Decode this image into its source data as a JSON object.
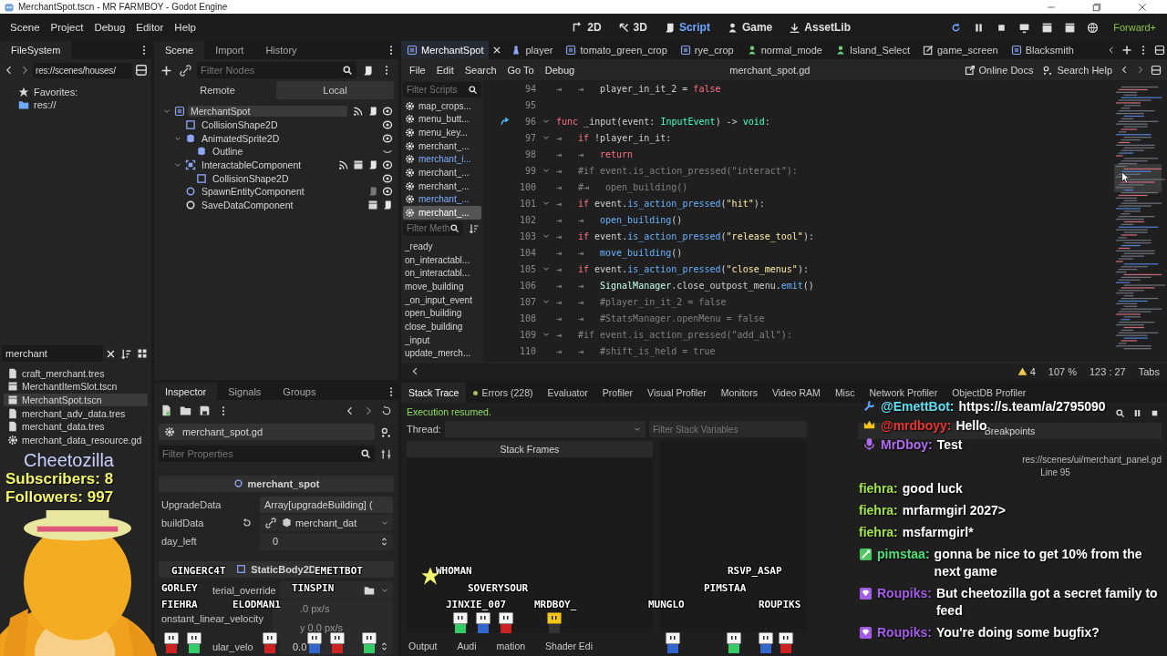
{
  "window": {
    "title": "MerchantSpot.tscn - MR FARMBOY - Godot Engine"
  },
  "menu": [
    "Scene",
    "Project",
    "Debug",
    "Editor",
    "Help"
  ],
  "workspaces": [
    {
      "label": "2D",
      "kind": "plane",
      "selected": false
    },
    {
      "label": "3D",
      "kind": "space",
      "selected": false
    },
    {
      "label": "Script",
      "kind": "script",
      "selected": true
    },
    {
      "label": "Game",
      "kind": "game",
      "selected": false
    },
    {
      "label": "AssetLib",
      "kind": "assetlib",
      "selected": false
    }
  ],
  "renderer": "Forward+",
  "filesystem": {
    "title": "FileSystem",
    "path": "res://scenes/houses/",
    "favorites": [
      {
        "label": "Favorites:",
        "kind": "star"
      },
      {
        "label": "res://",
        "kind": "folder"
      }
    ],
    "search": {
      "value": "merchant"
    },
    "files": [
      {
        "name": "craft_merchant.tres",
        "kind": "file",
        "selected": false
      },
      {
        "name": "MerchantItemSlot.tscn",
        "kind": "scene",
        "selected": false
      },
      {
        "name": "MerchantSpot.tscn",
        "kind": "scene",
        "selected": true
      },
      {
        "name": "merchant_adv_data.tres",
        "kind": "file",
        "selected": false
      },
      {
        "name": "merchant_data.tres",
        "kind": "file",
        "selected": false
      },
      {
        "name": "merchant_data_resource.gd",
        "kind": "gear",
        "selected": false
      }
    ]
  },
  "scene_dock": {
    "tabs": [
      {
        "label": "Scene",
        "selected": true
      },
      {
        "label": "Import",
        "selected": false
      },
      {
        "label": "History",
        "selected": false
      }
    ],
    "filter": {
      "placeholder": "Filter Nodes"
    },
    "modes": [
      {
        "label": "Remote",
        "selected": false
      },
      {
        "label": "Local",
        "selected": true
      }
    ],
    "nodes": [
      {
        "name": "MerchantSpot",
        "kind": "node",
        "selected": true,
        "badges": [
          {
            "kind": "signal"
          },
          {
            "kind": "script"
          },
          {
            "kind": "eye"
          }
        ],
        "children": [
          {
            "name": "CollisionShape2D",
            "kind": "shape",
            "selected": false,
            "badges": [
              {
                "kind": "eye"
              }
            ]
          },
          {
            "name": "AnimatedSprite2D",
            "kind": "sprite",
            "selected": false,
            "badges": [
              {
                "kind": "eye"
              }
            ],
            "children": [
              {
                "name": "Outline",
                "kind": "sprite",
                "selected": false,
                "badges": [
                  {
                    "kind": "hidden"
                  }
                ]
              }
            ]
          },
          {
            "name": "InteractableComponent",
            "kind": "area",
            "selected": false,
            "badges": [
              {
                "kind": "signal"
              },
              {
                "kind": "clapper"
              },
              {
                "kind": "script"
              },
              {
                "kind": "eye"
              }
            ],
            "children": [
              {
                "name": "CollisionShape2D",
                "kind": "shape",
                "selected": false,
                "badges": [
                  {
                    "kind": "eye"
                  }
                ]
              }
            ]
          },
          {
            "name": "SpawnEntityComponent",
            "kind": "circle",
            "selected": false,
            "badges": [
              {
                "kind": "dimscript"
              },
              {
                "kind": "eye"
              }
            ]
          },
          {
            "name": "SaveDataComponent",
            "kind": "ring",
            "selected": false,
            "badges": [
              {
                "kind": "clapper"
              },
              {
                "kind": "script"
              }
            ]
          }
        ]
      }
    ]
  },
  "script_editor": {
    "tabs": [
      {
        "label": "MerchantSpot",
        "kind": "node",
        "selected": true
      },
      {
        "label": "player",
        "kind": "character",
        "selected": false
      },
      {
        "label": "tomato_green_crop",
        "kind": "node",
        "selected": false
      },
      {
        "label": "rye_crop",
        "kind": "node",
        "selected": false
      },
      {
        "label": "normal_mode",
        "kind": "person",
        "selected": false
      },
      {
        "label": "Island_Select",
        "kind": "person",
        "selected": false
      },
      {
        "label": "game_screen",
        "kind": "edit",
        "selected": false
      },
      {
        "label": "Blacksmith",
        "kind": "node",
        "selected": false
      }
    ],
    "menu": [
      "File",
      "Edit",
      "Search",
      "Go To",
      "Debug"
    ],
    "file": "merchant_spot.gd",
    "help": [
      {
        "label": "Online Docs",
        "kind": "docs"
      },
      {
        "label": "Search Help",
        "kind": "help"
      }
    ],
    "scripts": {
      "placeholder": "Filter Scripts",
      "items": [
        {
          "name": "map_crops...",
          "highlighted": false,
          "selected": false
        },
        {
          "name": "menu_butt...",
          "highlighted": false,
          "selected": false
        },
        {
          "name": "menu_key...",
          "highlighted": false,
          "selected": false
        },
        {
          "name": "merchant_...",
          "highlighted": false,
          "selected": false
        },
        {
          "name": "merchant_i...",
          "highlighted": true,
          "selected": false
        },
        {
          "name": "merchant_...",
          "highlighted": false,
          "selected": false
        },
        {
          "name": "merchant_...",
          "highlighted": false,
          "selected": false
        },
        {
          "name": "merchant_...",
          "highlighted": true,
          "selected": false
        },
        {
          "name": "merchant_...",
          "highlighted": false,
          "selected": true
        }
      ]
    },
    "methods": {
      "placeholder": "Filter Meth",
      "items": [
        "_ready",
        "on_interactabl...",
        "on_interactabl...",
        "move_building",
        "_on_input_event",
        "open_building",
        "close_building",
        "_input",
        "update_merch..."
      ]
    },
    "code": [
      {
        "number": "94",
        "foldable": false,
        "connection": false,
        "tokens": [
          {
            "kind": "tab",
            "t": "⇥"
          },
          {
            "kind": "tab",
            "t": "⇥"
          },
          {
            "kind": "plain",
            "t": "player_in_it_2 = "
          },
          {
            "kind": "keyword",
            "t": "false"
          }
        ]
      },
      {
        "number": "95",
        "foldable": false,
        "connection": false
      },
      {
        "number": "96",
        "foldable": true,
        "connection": true,
        "tokens": [
          {
            "kind": "keyword",
            "t": "func"
          },
          {
            "kind": "plain",
            "t": " _input(event: "
          },
          {
            "kind": "type",
            "t": "InputEvent"
          },
          {
            "kind": "plain",
            "t": ") -> "
          },
          {
            "kind": "type",
            "t": "void"
          },
          {
            "kind": "plain",
            "t": ":"
          }
        ]
      },
      {
        "number": "97",
        "foldable": true,
        "connection": false,
        "tokens": [
          {
            "kind": "tab",
            "t": "⇥"
          },
          {
            "kind": "keyword",
            "t": "if"
          },
          {
            "kind": "plain",
            "t": " !player_in_it:"
          }
        ]
      },
      {
        "number": "98",
        "foldable": false,
        "connection": false,
        "tokens": [
          {
            "kind": "tab",
            "t": "⇥"
          },
          {
            "kind": "tab",
            "t": "⇥"
          },
          {
            "kind": "keyword",
            "t": "return"
          }
        ]
      },
      {
        "number": "99",
        "foldable": true,
        "connection": false,
        "tokens": [
          {
            "kind": "tab",
            "t": "⇥"
          },
          {
            "kind": "comment",
            "t": "#if event.is_action_pressed(\"interact\"):"
          }
        ]
      },
      {
        "number": "100",
        "foldable": false,
        "connection": false,
        "tokens": [
          {
            "kind": "tab",
            "t": "⇥"
          },
          {
            "kind": "comment",
            "t": "#"
          },
          {
            "kind": "tab",
            "t": "⇥"
          },
          {
            "kind": "comment",
            "t": "open_building()"
          }
        ]
      },
      {
        "number": "101",
        "foldable": true,
        "connection": false,
        "tokens": [
          {
            "kind": "tab",
            "t": "⇥"
          },
          {
            "kind": "keyword",
            "t": "if"
          },
          {
            "kind": "plain",
            "t": " event."
          },
          {
            "kind": "function",
            "t": "is_action_pressed"
          },
          {
            "kind": "plain",
            "t": "("
          },
          {
            "kind": "string",
            "t": "\"hit\""
          },
          {
            "kind": "plain",
            "t": "):"
          }
        ]
      },
      {
        "number": "102",
        "foldable": false,
        "connection": false,
        "tokens": [
          {
            "kind": "tab",
            "t": "⇥"
          },
          {
            "kind": "tab",
            "t": "⇥"
          },
          {
            "kind": "function",
            "t": "open_building"
          },
          {
            "kind": "plain",
            "t": "()"
          }
        ]
      },
      {
        "number": "103",
        "foldable": true,
        "connection": false,
        "tokens": [
          {
            "kind": "tab",
            "t": "⇥"
          },
          {
            "kind": "keyword",
            "t": "if"
          },
          {
            "kind": "plain",
            "t": " event."
          },
          {
            "kind": "function",
            "t": "is_action_pressed"
          },
          {
            "kind": "plain",
            "t": "("
          },
          {
            "kind": "string",
            "t": "\"release_tool\""
          },
          {
            "kind": "plain",
            "t": "):"
          }
        ]
      },
      {
        "number": "104",
        "foldable": false,
        "connection": false,
        "tokens": [
          {
            "kind": "tab",
            "t": "⇥"
          },
          {
            "kind": "tab",
            "t": "⇥"
          },
          {
            "kind": "function",
            "t": "move_building"
          },
          {
            "kind": "plain",
            "t": "()"
          }
        ]
      },
      {
        "number": "105",
        "foldable": true,
        "connection": false,
        "tokens": [
          {
            "kind": "tab",
            "t": "⇥"
          },
          {
            "kind": "keyword",
            "t": "if"
          },
          {
            "kind": "plain",
            "t": " event."
          },
          {
            "kind": "function",
            "t": "is_action_pressed"
          },
          {
            "kind": "plain",
            "t": "("
          },
          {
            "kind": "string",
            "t": "\"close_menus\""
          },
          {
            "kind": "plain",
            "t": "):"
          }
        ]
      },
      {
        "number": "106",
        "foldable": false,
        "connection": false,
        "tokens": [
          {
            "kind": "tab",
            "t": "⇥"
          },
          {
            "kind": "tab",
            "t": "⇥"
          },
          {
            "kind": "class",
            "t": "SignalManager"
          },
          {
            "kind": "plain",
            "t": ".close_outpost_menu."
          },
          {
            "kind": "function",
            "t": "emit"
          },
          {
            "kind": "plain",
            "t": "()"
          }
        ]
      },
      {
        "number": "107",
        "foldable": true,
        "connection": false,
        "tokens": [
          {
            "kind": "tab",
            "t": "⇥"
          },
          {
            "kind": "tab",
            "t": "⇥"
          },
          {
            "kind": "comment",
            "t": "#player_in_it_2 = false"
          }
        ]
      },
      {
        "number": "108",
        "foldable": false,
        "connection": false,
        "tokens": [
          {
            "kind": "tab",
            "t": "⇥"
          },
          {
            "kind": "tab",
            "t": "⇥"
          },
          {
            "kind": "comment",
            "t": "#StatsManager.openMenu = false"
          }
        ]
      },
      {
        "number": "109",
        "foldable": true,
        "connection": false,
        "tokens": [
          {
            "kind": "tab",
            "t": "⇥"
          },
          {
            "kind": "comment",
            "t": "#if event.is_action_pressed(\"add_all\"):"
          }
        ]
      },
      {
        "number": "110",
        "foldable": false,
        "connection": false,
        "tokens": [
          {
            "kind": "tab",
            "t": "⇥"
          },
          {
            "kind": "tab",
            "t": "⇥"
          },
          {
            "kind": "comment",
            "t": "#shift_is_held = true"
          }
        ]
      }
    ],
    "status": {
      "warnings": "4",
      "zoom": "107 %",
      "position": "123 : 27",
      "indent": "Tabs"
    }
  },
  "inspector": {
    "tabs": [
      {
        "label": "Inspector",
        "selected": true
      },
      {
        "label": "Signals",
        "selected": false
      },
      {
        "label": "Groups",
        "selected": false
      }
    ],
    "script": "merchant_spot.gd",
    "filter": {
      "placeholder": "Filter Properties"
    },
    "sections": [
      {
        "title": "merchant_spot",
        "kind": "script",
        "properties": [
          {
            "name": "UpgradeData",
            "kind": "array",
            "value": "Array[upgradeBuilding] ("
          },
          {
            "name": "buildData",
            "kind": "resource",
            "value": "merchant_dat"
          },
          {
            "name": "day_left",
            "kind": "number",
            "value": "0"
          }
        ]
      },
      {
        "title": "StaticBody2D",
        "kind": "node",
        "properties": [
          {
            "name": "terial_override",
            "kind": "picker"
          },
          {
            "name": "onstant_linear_velocity",
            "kind": "vector",
            "values": [
              ".0 px/s",
              "y   0.0 px/s"
            ]
          },
          {
            "name": "ular_velo",
            "kind": "number",
            "value": "0.0"
          }
        ]
      }
    ]
  },
  "bottom_panel": {
    "tabs": [
      {
        "label": "Stack Trace",
        "selected": true
      },
      {
        "label": "Errors (228)",
        "selected": false
      },
      {
        "label": "Evaluator",
        "selected": false
      },
      {
        "label": "Profiler",
        "selected": false
      },
      {
        "label": "Visual Profiler",
        "selected": false
      },
      {
        "label": "Monitors",
        "selected": false
      },
      {
        "label": "Video RAM",
        "selected": false
      },
      {
        "label": "Misc",
        "selected": false
      },
      {
        "label": "Network Profiler",
        "selected": false
      },
      {
        "label": "ObjectDB Profiler",
        "selected": false
      }
    ],
    "message": "Execution resumed.",
    "thread_label": "Thread:",
    "filter": {
      "placeholder": "Filter Stack Variables"
    },
    "frames_header": "Stack Frames",
    "breakpoints": {
      "title": "Breakpoints",
      "file": "res://scenes/ui/merchant_panel.gd",
      "line": "Line 95"
    },
    "docks": [
      "Output",
      "Audi",
      "mation",
      "Shader Edi"
    ]
  },
  "stream_overlay": {
    "channel": "Cheetozilla",
    "subscribers": "Subscribers: 8",
    "followers": "Followers: 997",
    "viewers": [
      "GINGERC4T",
      "EMETTBOT",
      "GORLEY",
      "TINSPIN",
      "FIEHRA",
      "ELODMAN1",
      "WHOMAN",
      "SOVERYSOUR",
      "JINXIE_007",
      "MRDBOY_",
      "MUNGLO",
      "RSVP_ASAP",
      "PIMSTAA",
      "ROUPIKS"
    ],
    "pinned": [
      {
        "user": "@EmettBot:",
        "text": "https://s.team/a/2795090",
        "kind": "wrench",
        "color": "#5fe0f0"
      },
      {
        "user": "@mrdboyy:",
        "text": "Hello",
        "kind": "crown",
        "color": "#e8332f"
      },
      {
        "user": "MrDboy:",
        "text": "Test",
        "kind": "mic",
        "color": "#b06bf0"
      }
    ],
    "chat": [
      {
        "user": "fiehra:",
        "text": "good luck",
        "kind": "plain",
        "color": "#a4e34d"
      },
      {
        "user": "fiehra:",
        "text": "mrfarmgirl 2027>",
        "kind": "plain",
        "color": "#a4e34d"
      },
      {
        "user": "fiehra:",
        "text": "msfarmgirl*",
        "kind": "plain",
        "color": "#a4e34d"
      },
      {
        "user": "pimstaa:",
        "text": "gonna be nice to get 10% from the next game",
        "kind": "sword",
        "color": "#4fe07a"
      },
      {
        "user": "Roupiks:",
        "text": "But cheetozilla got a secret family to feed",
        "kind": "gem",
        "color": "#a35ce6"
      },
      {
        "user": "Roupiks:",
        "text": "You're doing some bugfix?",
        "kind": "gem",
        "color": "#a35ce6"
      }
    ]
  }
}
